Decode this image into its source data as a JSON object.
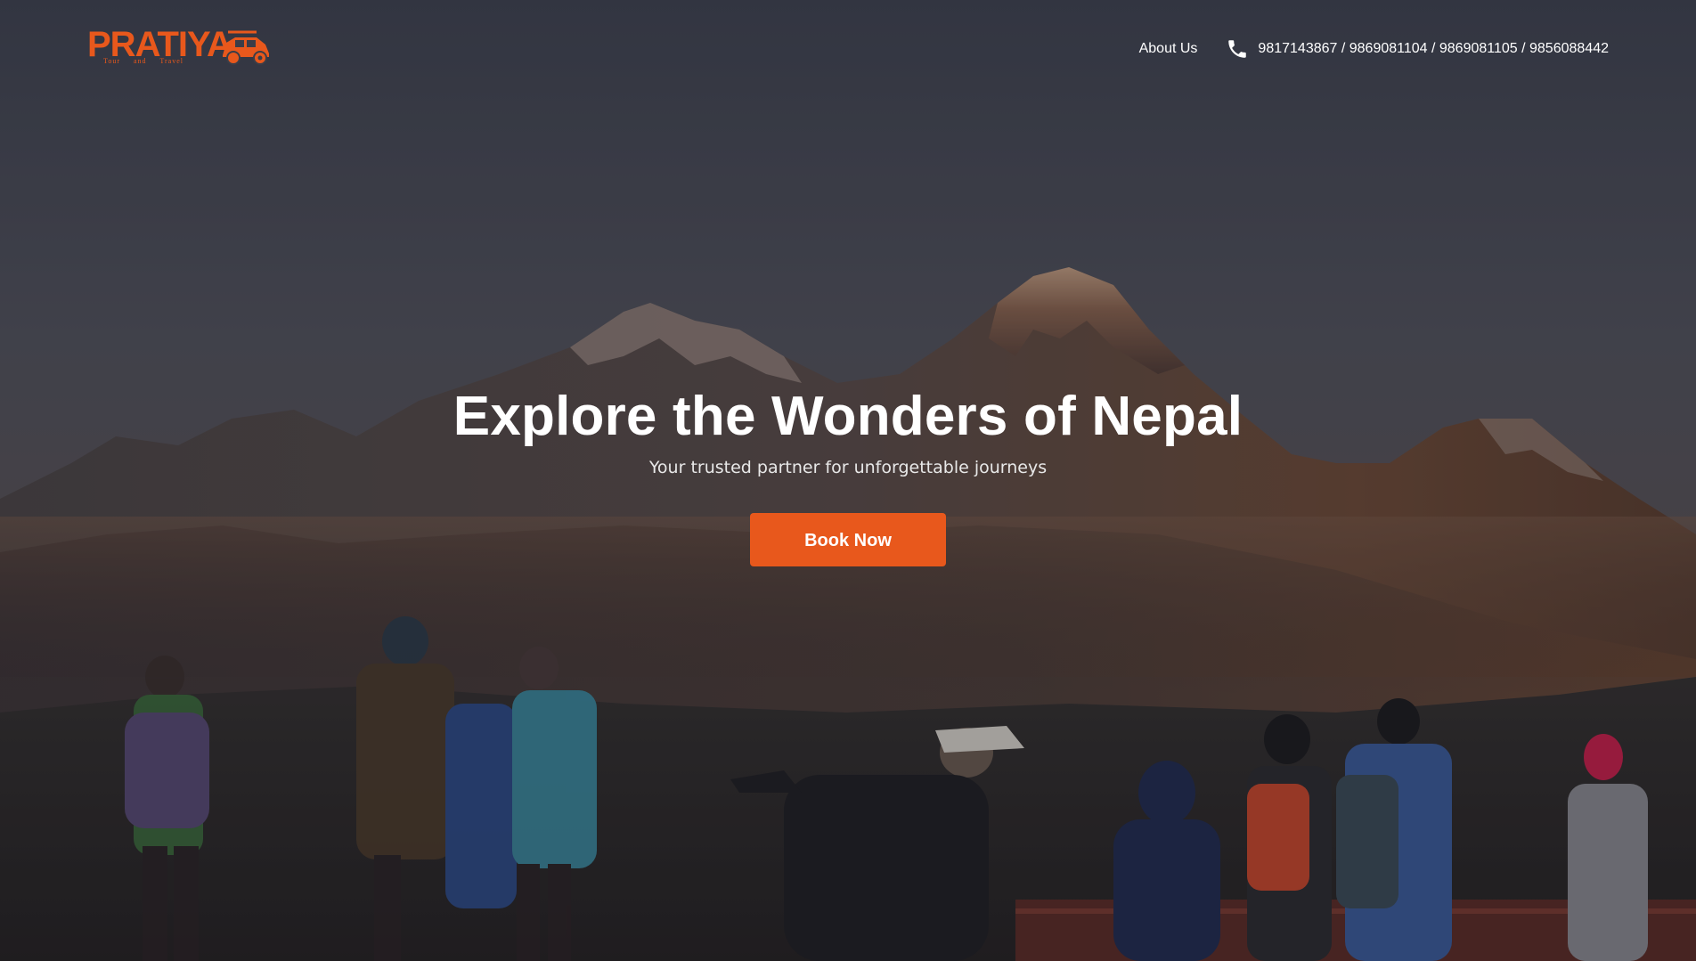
{
  "brand": {
    "name": "PRATIYA",
    "tagline": "Tour and Travel",
    "color": "#e8581c"
  },
  "nav": {
    "about_label": "About Us",
    "phone_icon": "phone-icon",
    "phone_numbers": "9817143867 / 9869081104 / 9869081105 / 9856088442"
  },
  "hero": {
    "title": "Explore the Wonders of Nepal",
    "subtitle": "Your trusted partner for unforgettable journeys",
    "cta_label": "Book Now",
    "cta_color": "#e8581c"
  }
}
